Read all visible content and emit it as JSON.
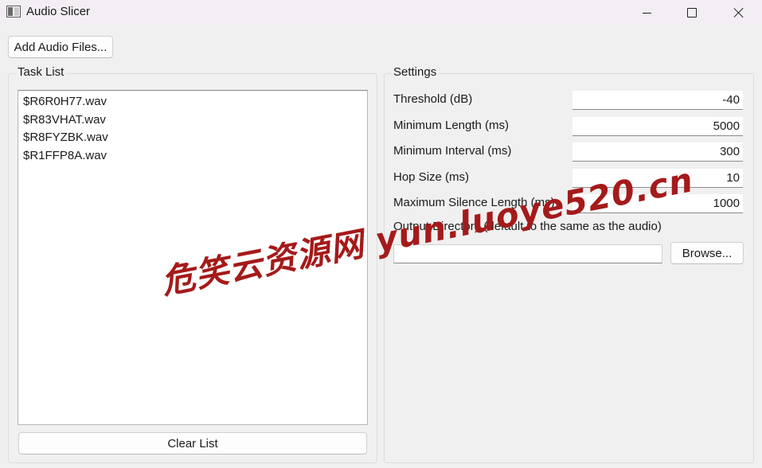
{
  "window": {
    "title": "Audio Slicer",
    "icons": {
      "app": "app-icon",
      "minimize": "minimize-icon",
      "maximize": "maximize-icon",
      "close": "close-icon"
    }
  },
  "toolbar": {
    "add_label": "Add Audio Files..."
  },
  "task_list": {
    "title": "Task List",
    "items": [
      "$R6R0H77.wav",
      "$R83VHAT.wav",
      "$R8FYZBK.wav",
      "$R1FFP8A.wav"
    ],
    "clear_label": "Clear List"
  },
  "settings": {
    "title": "Settings",
    "threshold": {
      "label": "Threshold (dB)",
      "value": "-40"
    },
    "min_length": {
      "label": "Minimum Length (ms)",
      "value": "5000"
    },
    "min_interval": {
      "label": "Minimum Interval (ms)",
      "value": "300"
    },
    "hop_size": {
      "label": "Hop Size (ms)",
      "value": "10"
    },
    "max_silence": {
      "label": "Maximum Silence Length (ms)",
      "value": "1000"
    },
    "output_dir": {
      "label": "Output Directory (default to the same as the audio)",
      "value": ""
    },
    "browse_label": "Browse..."
  },
  "watermark": {
    "text": "危笑云资源网  yun.luoye520.cn",
    "color": "#a51a1a"
  }
}
